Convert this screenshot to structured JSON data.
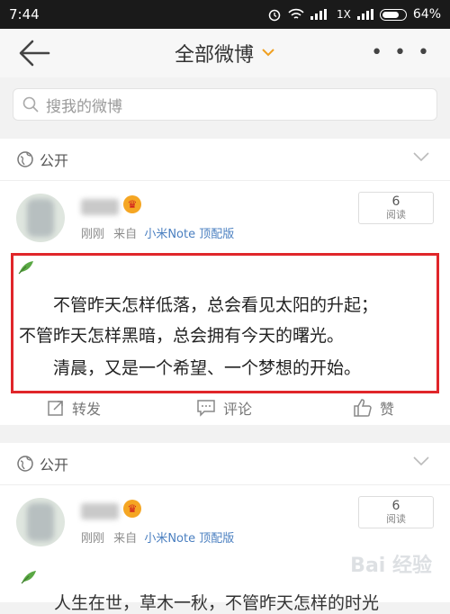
{
  "status": {
    "time": "7:44",
    "network": "1X",
    "battery": "64%"
  },
  "header": {
    "title": "全部微博",
    "more": "• • •"
  },
  "search": {
    "placeholder": "搜我的微博"
  },
  "posts": [
    {
      "visibility": "公开",
      "read_count": "6",
      "read_label": "阅读",
      "time": "刚刚",
      "source_prefix": "来自",
      "source": "小米Note 顶配版",
      "lines": [
        "不管昨天怎样低落，总会看见太阳的升起；",
        "不管昨天怎样黑暗，总会拥有今天的曙光。",
        "清晨，又是一个希望、一个梦想的开始。"
      ],
      "actions": {
        "repost": "转发",
        "comment": "评论",
        "like": "赞"
      }
    },
    {
      "visibility": "公开",
      "read_count": "6",
      "read_label": "阅读",
      "time": "刚刚",
      "source_prefix": "来自",
      "source": "小米Note 顶配版",
      "partial_text": "人生在世，草木一秋，不管昨天怎样的时光"
    }
  ],
  "watermark": "Bai 经验"
}
